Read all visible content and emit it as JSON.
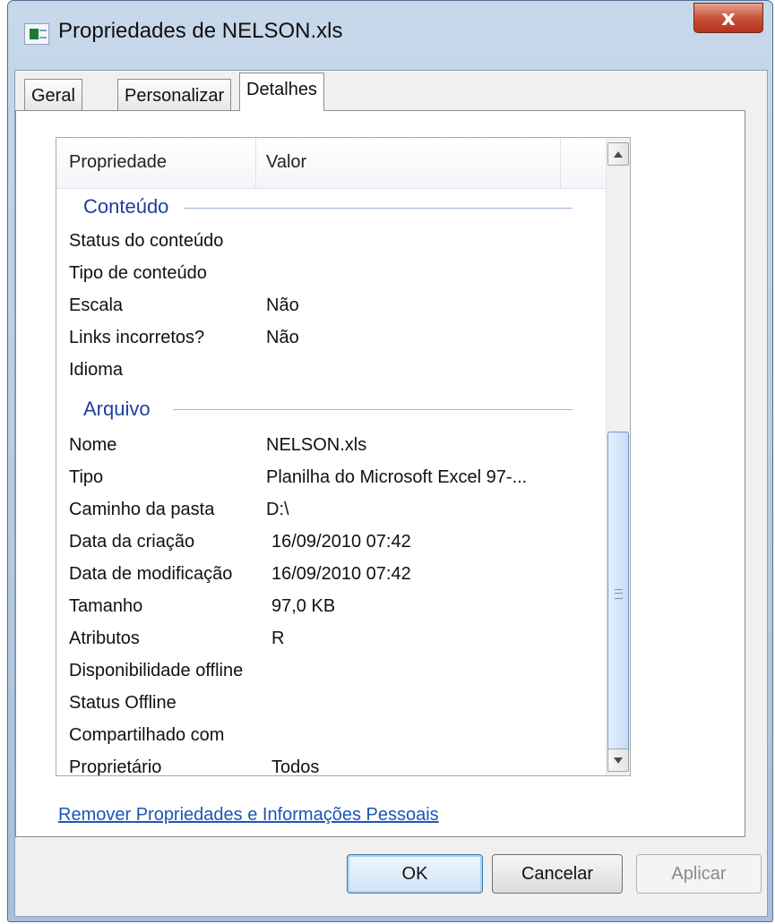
{
  "window": {
    "title": "Propriedades de NELSON.xls",
    "close_label": "x",
    "title_icon": "excel-file-icon"
  },
  "tabs": [
    {
      "label": "Geral",
      "active": false
    },
    {
      "label": "Personalizar",
      "active": false
    },
    {
      "label": "Detalhes",
      "active": true
    }
  ],
  "list": {
    "columns": {
      "property": "Propriedade",
      "value": "Valor"
    },
    "groups": [
      {
        "title": "Conteúdo",
        "rows": [
          {
            "name": "Status do conteúdo",
            "value": ""
          },
          {
            "name": "Tipo de conteúdo",
            "value": ""
          },
          {
            "name": "Escala",
            "value": "Não"
          },
          {
            "name": "Links incorretos?",
            "value": "Não"
          },
          {
            "name": "Idioma",
            "value": ""
          }
        ]
      },
      {
        "title": "Arquivo",
        "rows": [
          {
            "name": "Nome",
            "value": "NELSON.xls"
          },
          {
            "name": "Tipo",
            "value": "Planilha do Microsoft Excel 97-..."
          },
          {
            "name": "Caminho da pasta",
            "value": "D:\\"
          },
          {
            "name": "Data da criação",
            "value": "16/09/2010 07:42"
          },
          {
            "name": "Data de modificação",
            "value": "16/09/2010 07:42"
          },
          {
            "name": "Tamanho",
            "value": "97,0 KB"
          },
          {
            "name": "Atributos",
            "value": "R"
          },
          {
            "name": "Disponibilidade offline",
            "value": ""
          },
          {
            "name": "Status Offline",
            "value": ""
          },
          {
            "name": "Compartilhado com",
            "value": ""
          },
          {
            "name": "Proprietário",
            "value": "Todos"
          }
        ]
      }
    ]
  },
  "link": {
    "label": "Remover Propriedades e Informações Pessoais"
  },
  "buttons": {
    "ok": "OK",
    "cancel": "Cancelar",
    "apply": "Aplicar"
  },
  "colors": {
    "group_header": "#1e3f9e",
    "link": "#1c56b8",
    "close_button": "#c8533b"
  }
}
